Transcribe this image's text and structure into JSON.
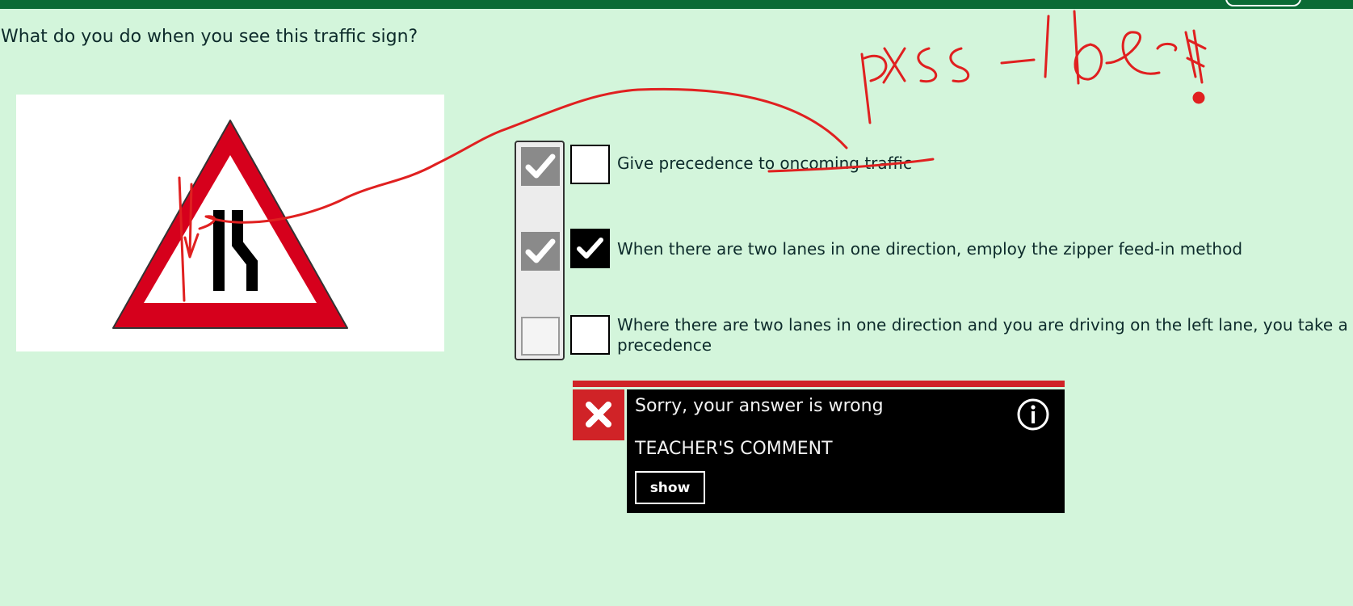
{
  "question": "What do you do when you see this traffic sign?",
  "sign": {
    "name": "road-narrows-on-right-sign"
  },
  "options": [
    {
      "label": "Give precedence to oncoming traffic",
      "correct": true,
      "selected": false
    },
    {
      "label": "When there are two lanes in one direction, employ the zipper feed-in method",
      "correct": true,
      "selected": true
    },
    {
      "label": "Where there are two lanes in one direction and you are driving on the left lane, you take a",
      "label_cont": "precedence",
      "correct": false,
      "selected": false
    }
  ],
  "feedback": {
    "title": "Sorry, your answer is wrong",
    "teacher_title": "TEACHER'S COMMENT",
    "show_label": "show"
  },
  "colors": {
    "background": "#d3f5db",
    "topbar": "#0b6b35",
    "error_red": "#d02327",
    "annotation_red": "#e02020"
  }
}
